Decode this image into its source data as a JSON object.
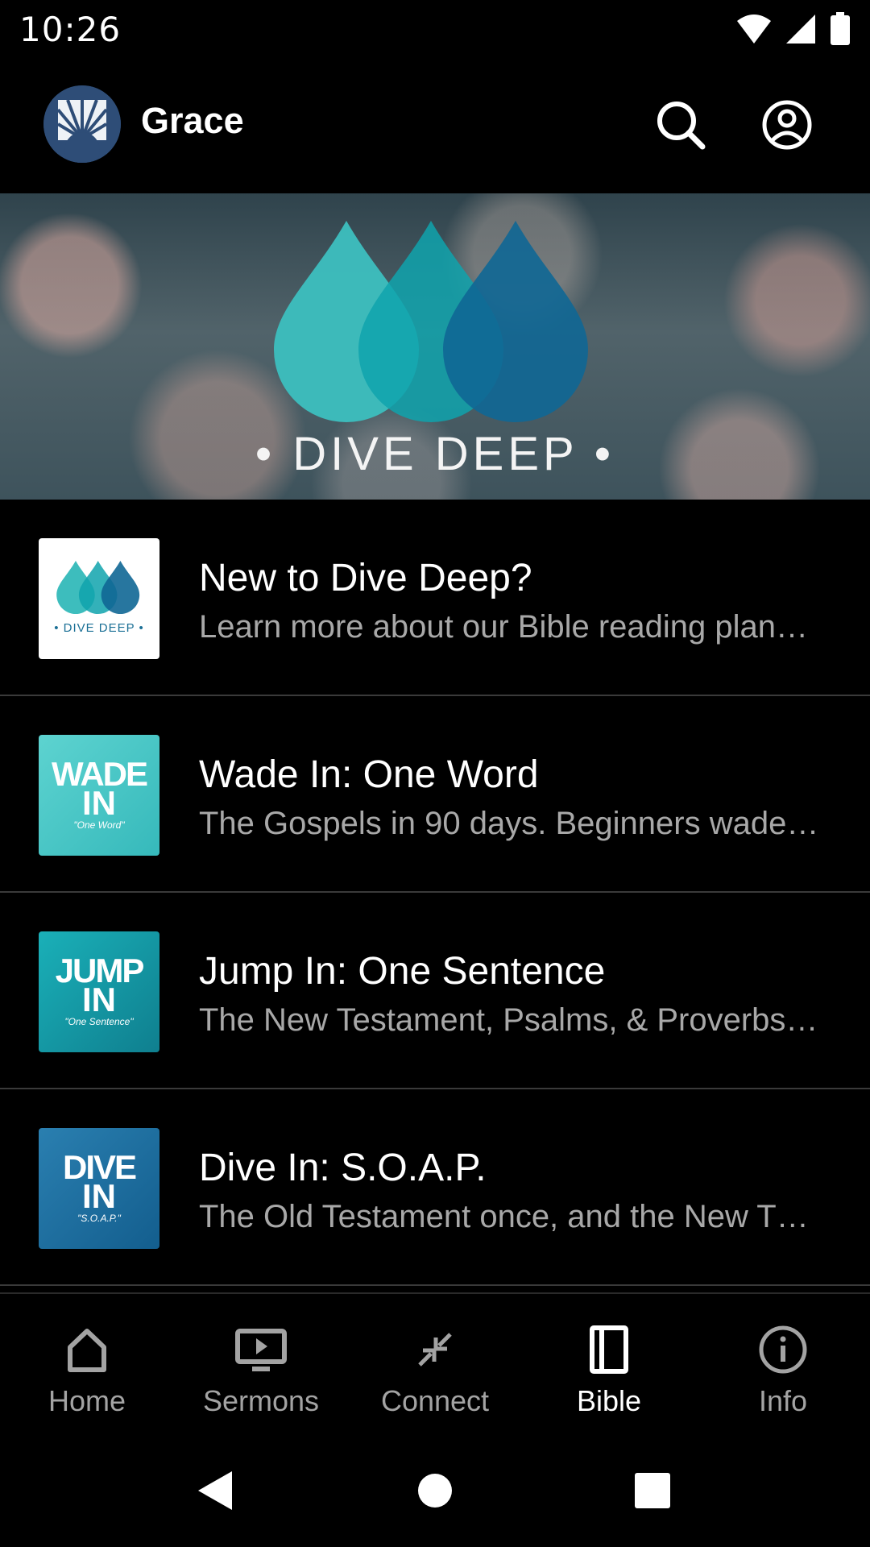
{
  "status": {
    "time": "10:26"
  },
  "app": {
    "title": "Grace"
  },
  "banner": {
    "text": "• DIVE DEEP •"
  },
  "plans": [
    {
      "title": "New to Dive Deep?",
      "subtitle": "Learn more about our Bible reading plan…",
      "thumb_text": "• DIVE DEEP •"
    },
    {
      "title": "Wade In: One Word",
      "subtitle": "The Gospels in 90 days. Beginners wade…",
      "thumb_line1": "WADE",
      "thumb_line2": "IN",
      "thumb_caption": "\"One Word\""
    },
    {
      "title": "Jump In: One Sentence",
      "subtitle": "The New Testament, Psalms, & Proverbs…",
      "thumb_line1": "JUMP",
      "thumb_line2": "IN",
      "thumb_caption": "\"One Sentence\""
    },
    {
      "title": "Dive In: S.O.A.P.",
      "subtitle": "The Old Testament once, and the New T…",
      "thumb_line1": "DIVE",
      "thumb_line2": "IN",
      "thumb_caption": "\"S.O.A.P.\""
    }
  ],
  "nav": {
    "items": [
      {
        "label": "Home",
        "icon": "home-icon"
      },
      {
        "label": "Sermons",
        "icon": "tv-play-icon"
      },
      {
        "label": "Connect",
        "icon": "connect-arrows-icon"
      },
      {
        "label": "Bible",
        "icon": "book-icon",
        "active": true
      },
      {
        "label": "Info",
        "icon": "info-icon"
      }
    ]
  },
  "colors": {
    "background": "#000000",
    "active": "#ffffff",
    "inactive": "#a3a3a3",
    "drop_light": "#3dbdbd",
    "drop_mid": "#0f9fab",
    "drop_dark": "#0f6795"
  }
}
